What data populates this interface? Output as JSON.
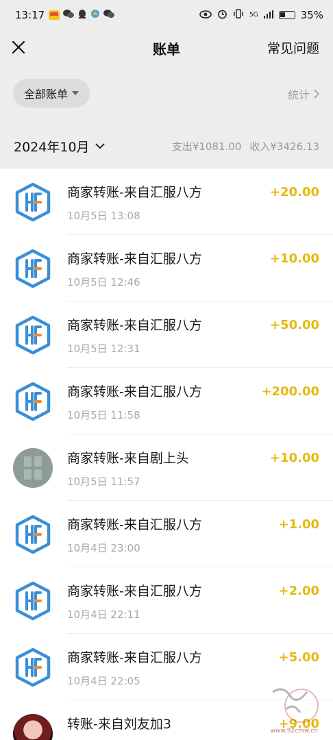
{
  "status_bar": {
    "time": "13:17",
    "battery": "35%",
    "network": "5G"
  },
  "nav": {
    "title": "账单",
    "faq": "常见问题"
  },
  "filter": {
    "chip_label": "全部账单",
    "stats_label": "统计"
  },
  "month": {
    "label": "2024年10月",
    "expense": "支出¥1081.00",
    "income": "收入¥3426.13"
  },
  "bills": [
    {
      "title": "商家转账-来自汇服八方",
      "time": "10月5日 13:08",
      "amount": "+20.00",
      "avatar": "hf"
    },
    {
      "title": "商家转账-来自汇服八方",
      "time": "10月5日 12:46",
      "amount": "+10.00",
      "avatar": "hf"
    },
    {
      "title": "商家转账-来自汇服八方",
      "time": "10月5日 12:31",
      "amount": "+50.00",
      "avatar": "hf"
    },
    {
      "title": "商家转账-来自汇服八方",
      "time": "10月5日 11:58",
      "amount": "+200.00",
      "avatar": "hf"
    },
    {
      "title": "商家转账-来自剧上头",
      "time": "10月5日 11:57",
      "amount": "+10.00",
      "avatar": "grid"
    },
    {
      "title": "商家转账-来自汇服八方",
      "time": "10月4日 23:00",
      "amount": "+1.00",
      "avatar": "hf"
    },
    {
      "title": "商家转账-来自汇服八方",
      "time": "10月4日 22:11",
      "amount": "+2.00",
      "avatar": "hf"
    },
    {
      "title": "商家转账-来自汇服八方",
      "time": "10月4日 22:05",
      "amount": "+5.00",
      "avatar": "hf"
    },
    {
      "title": "转账-来自刘友加3",
      "time": "",
      "amount": "+9.00",
      "avatar": "photo"
    }
  ],
  "watermark": {
    "url": "www.92cmw.cn"
  },
  "colors": {
    "income": "#e7b80f",
    "background_top": "#ededed",
    "hf_logo_blue": "#3a8fd8",
    "hf_logo_orange": "#f08a24"
  }
}
